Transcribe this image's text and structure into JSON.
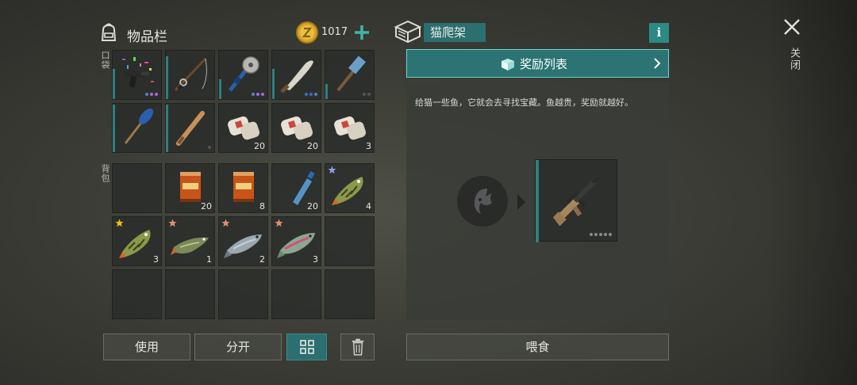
{
  "inventory": {
    "title": "物品栏",
    "coins": "1017",
    "pockets_label": "口袋",
    "backpack_label": "背包",
    "pockets": [
      {
        "icon": "party-pistol-icon",
        "count": "",
        "dots": [
          "#5a7ec8",
          "#a86ad6",
          "#a86ad6"
        ],
        "durability": 0.6
      },
      {
        "icon": "fishing-rod-icon",
        "count": "",
        "dots": [],
        "durability": 0.85
      },
      {
        "icon": "saw-mace-icon",
        "count": "",
        "dots": [
          "#5a7ec8",
          "#a86ad6",
          "#a86ad6"
        ],
        "durability": 0.4
      },
      {
        "icon": "machete-icon",
        "count": "",
        "dots": [
          "#3d6ec0",
          "#3d6ec0",
          "#5a7ec8"
        ],
        "durability": 0.6
      },
      {
        "icon": "hammer-icon",
        "count": "",
        "dots": [
          "#55554f",
          "#55554f"
        ],
        "durability": 0.3
      },
      {
        "icon": "oar-icon",
        "count": "",
        "dots": [],
        "durability": 0.95
      },
      {
        "icon": "baseball-bat-icon",
        "count": "",
        "dots": [
          "#55554f"
        ],
        "durability": 0.95
      },
      {
        "icon": "bandage-icon",
        "count": "20",
        "dots": [],
        "durability": 0
      },
      {
        "icon": "bandage-icon",
        "count": "20",
        "dots": [],
        "durability": 0
      },
      {
        "icon": "bandage-icon",
        "count": "3",
        "dots": [],
        "durability": 0
      }
    ],
    "backpack": [
      {
        "icon": "",
        "count": "",
        "star": ""
      },
      {
        "icon": "food-can-icon",
        "count": "20",
        "star": ""
      },
      {
        "icon": "food-can-icon",
        "count": "8",
        "star": ""
      },
      {
        "icon": "water-bottle-icon",
        "count": "20",
        "star": ""
      },
      {
        "icon": "perch-fish-icon",
        "count": "4",
        "star": "#8aa0e0"
      },
      {
        "icon": "perch-fish-icon",
        "count": "3",
        "star": "#f0c020"
      },
      {
        "icon": "pike-fish-icon",
        "count": "1",
        "star": "#e09070"
      },
      {
        "icon": "salmon-fish-icon",
        "count": "2",
        "star": "#e09070"
      },
      {
        "icon": "trout-fish-icon",
        "count": "3",
        "star": "#e09070"
      },
      {
        "icon": "",
        "count": "",
        "star": ""
      },
      {
        "icon": "",
        "count": "",
        "star": ""
      },
      {
        "icon": "",
        "count": "",
        "star": ""
      },
      {
        "icon": "",
        "count": "",
        "star": ""
      },
      {
        "icon": "",
        "count": "",
        "star": ""
      },
      {
        "icon": "",
        "count": "",
        "star": ""
      }
    ]
  },
  "actions": {
    "use": "使用",
    "split": "分开"
  },
  "cat_tree": {
    "title": "猫爬架",
    "info": "i",
    "reward_list": "奖励列表",
    "description": "给猫一些鱼，它就会去寻找宝藏。鱼越贵，奖励就越好。",
    "reward_item": "assault-rifle-icon",
    "feed": "喂食"
  },
  "close_label": "关闭",
  "colors": {
    "accent": "#2b6f70",
    "accent_bright": "#6fd5cf",
    "durability": "#2f7f80"
  }
}
